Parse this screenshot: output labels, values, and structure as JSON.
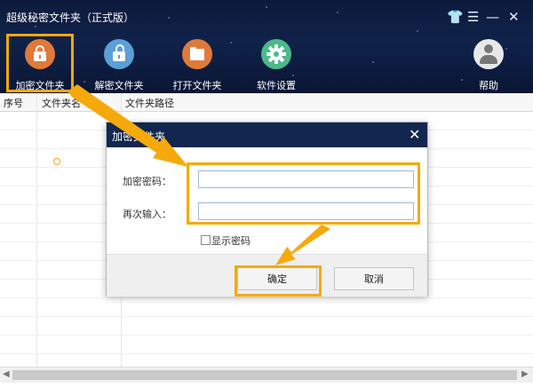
{
  "window": {
    "title": "超级秘密文件夹（正式版）"
  },
  "window_controls": {
    "shirt": "👕",
    "menu": "☰",
    "minimize": "—",
    "close": "✕"
  },
  "toolbar": {
    "items": [
      {
        "label": "加密文件夹",
        "icon": "lock-icon",
        "color": "#e07a3a"
      },
      {
        "label": "解密文件夹",
        "icon": "unlock-icon",
        "color": "#5aa0d6"
      },
      {
        "label": "打开文件夹",
        "icon": "folder-icon",
        "color": "#e07a3a"
      },
      {
        "label": "软件设置",
        "icon": "gear-icon",
        "color": "#4bb98a"
      },
      {
        "label": "帮助",
        "icon": "user-help-icon",
        "color": "#e8e8e8"
      }
    ]
  },
  "table": {
    "columns": [
      "序号",
      "文件夹名",
      "文件夹路径"
    ]
  },
  "dialog": {
    "title": "加密文件夹",
    "close": "✕",
    "password_label": "加密密码：",
    "password_value": "",
    "confirm_label": "再次输入：",
    "confirm_value": "",
    "show_password": "显示密码",
    "ok": "确定",
    "cancel": "取消"
  },
  "colors": {
    "accent": "#f5a90b",
    "titlebar": "#0f1f45",
    "dialog_title": "#12264f"
  }
}
